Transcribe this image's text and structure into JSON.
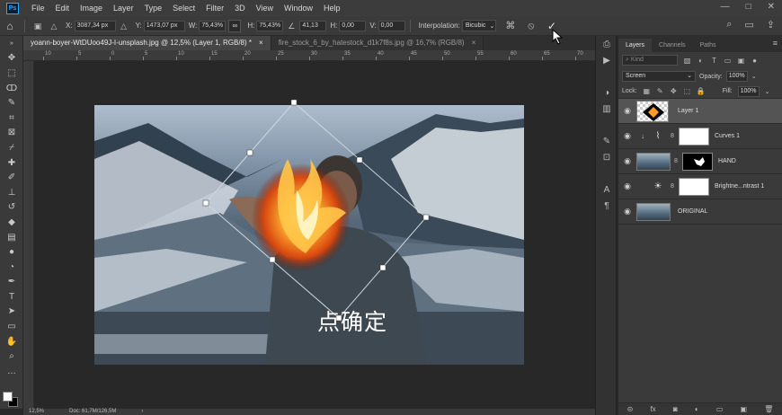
{
  "menubar": {
    "logo": "Ps",
    "items": [
      "File",
      "Edit",
      "Image",
      "Layer",
      "Type",
      "Select",
      "Filter",
      "3D",
      "View",
      "Window",
      "Help"
    ],
    "window_controls": [
      "—",
      "□",
      "✕"
    ]
  },
  "options": {
    "x_label": "X:",
    "x_value": "3087,34 px",
    "y_label": "Y:",
    "y_value": "1473,07 px",
    "w_label": "W:",
    "w_value": "75,43%",
    "link_label": "∞",
    "h_label": "H:",
    "h_value": "75,43%",
    "angle_value": "41,13",
    "hskew_label": "H:",
    "hskew_value": "0,00",
    "vskew_label": "V:",
    "vskew_value": "0,00",
    "interp_label": "Interpolation:",
    "interp_value": "Bicubic",
    "cancel_glyph": "⦸",
    "commit_glyph": "✓"
  },
  "tabs": [
    {
      "label": "yoann-boyer-WtDUoo49J-I-unsplash.jpg @ 12,5% (Layer 1, RGB/8) *",
      "close": "×"
    },
    {
      "label": "fire_stock_6_by_hatestock_d1k7f8s.jpg @ 16,7% (RGB/8)",
      "close": "×"
    }
  ],
  "ruler": {
    "ticks": [
      "10",
      "5",
      "0",
      "5",
      "10",
      "15",
      "20",
      "25",
      "30",
      "35",
      "40",
      "45",
      "50",
      "55",
      "60",
      "65",
      "70"
    ]
  },
  "subtitle": "点确定",
  "status": {
    "zoom": "12,5%",
    "doc": "Doc: 61,7M/126,5M",
    "arrow": "›"
  },
  "layers_panel": {
    "tabs": [
      "Layers",
      "Channels",
      "Paths"
    ],
    "menu": "≡",
    "kind_placeholder": "Kind",
    "blend_mode": "Screen",
    "opacity_label": "Opacity:",
    "opacity_value": "100%",
    "lock_label": "Lock:",
    "fill_label": "Fill:",
    "fill_value": "100%",
    "layers": [
      {
        "name": "Layer 1"
      },
      {
        "name": "Curves 1"
      },
      {
        "name": "HAND"
      },
      {
        "name": "Brightne...ntrast 1"
      },
      {
        "name": "ORIGINAL"
      }
    ],
    "bottom_icons": [
      "⊝",
      "fx",
      "◙",
      "◐",
      "▭",
      "▣",
      "🗑"
    ]
  },
  "colors": {
    "accent": "#31a8ff",
    "panel": "#3a3a3a",
    "selected_layer": "#545454"
  }
}
